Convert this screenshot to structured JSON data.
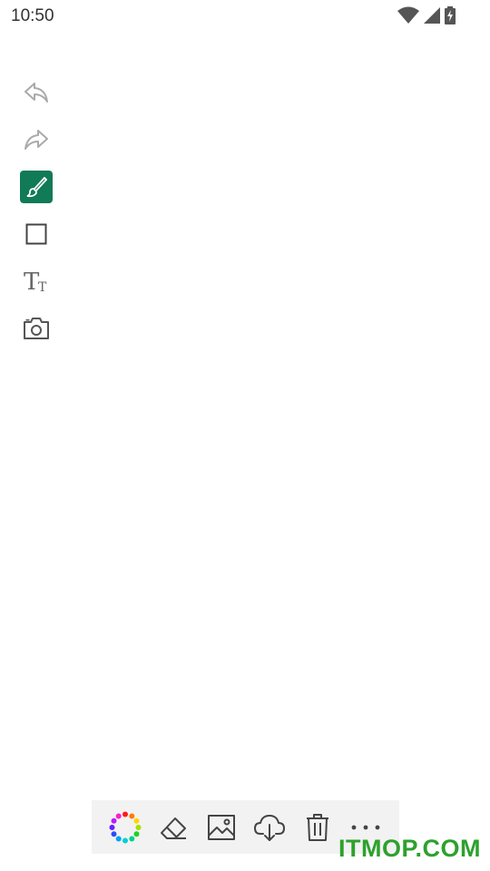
{
  "status_bar": {
    "time": "10:50",
    "icons": [
      "wifi-icon",
      "cellular-signal-icon",
      "battery-charging-icon"
    ]
  },
  "side_toolbar": {
    "items": [
      {
        "name": "undo",
        "icon": "undo-icon",
        "active": false
      },
      {
        "name": "redo",
        "icon": "redo-icon",
        "active": false
      },
      {
        "name": "brush",
        "icon": "brush-icon",
        "active": true
      },
      {
        "name": "shape",
        "icon": "square-icon",
        "active": false
      },
      {
        "name": "text",
        "icon": "text-size-icon",
        "label": "TT",
        "active": false
      },
      {
        "name": "camera",
        "icon": "camera-icon",
        "active": false
      }
    ],
    "active_color": "#117a57"
  },
  "bottom_toolbar": {
    "items": [
      {
        "name": "color-picker",
        "icon": "color-wheel-icon"
      },
      {
        "name": "eraser",
        "icon": "eraser-icon"
      },
      {
        "name": "image",
        "icon": "image-icon"
      },
      {
        "name": "download",
        "icon": "cloud-download-icon"
      },
      {
        "name": "delete",
        "icon": "trash-icon"
      },
      {
        "name": "more",
        "icon": "more-horizontal-icon"
      }
    ]
  },
  "watermark": {
    "text": "ITMOP.COM",
    "color": "#2da12d"
  }
}
